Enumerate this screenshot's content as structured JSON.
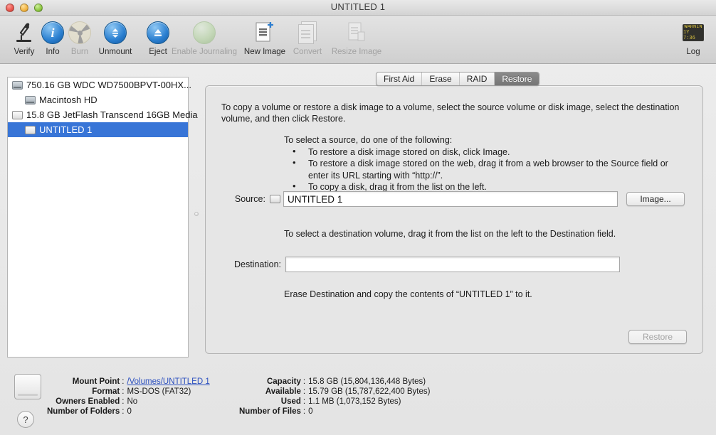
{
  "window": {
    "title": "UNTITLED 1",
    "traffic_lights": [
      "close",
      "minimize",
      "zoom"
    ]
  },
  "toolbar": {
    "items": [
      {
        "label": "Verify",
        "icon": "microscope-icon",
        "enabled": true
      },
      {
        "label": "Info",
        "icon": "info-circle-icon",
        "enabled": true
      },
      {
        "label": "Burn",
        "icon": "burn-radiation-icon",
        "enabled": false
      },
      {
        "label": "Unmount",
        "icon": "unmount-icon",
        "enabled": true
      },
      {
        "label": "Eject",
        "icon": "eject-icon",
        "enabled": true
      },
      {
        "label": "Enable Journaling",
        "icon": "journaling-sphere-icon",
        "enabled": false
      },
      {
        "label": "New Image",
        "icon": "new-image-icon",
        "enabled": true
      },
      {
        "label": "Convert",
        "icon": "convert-icon",
        "enabled": false
      },
      {
        "label": "Resize Image",
        "icon": "resize-image-icon",
        "enabled": false
      }
    ],
    "log": {
      "label": "Log",
      "icon": "log-console-icon",
      "line1": "WARNIN",
      "line2": "1Y 7:36"
    }
  },
  "sidebar": {
    "items": [
      {
        "label": "750.16 GB WDC WD7500BPVT-00HX...",
        "type": "disk",
        "indent": false,
        "selected": false
      },
      {
        "label": "Macintosh HD",
        "type": "volume",
        "indent": true,
        "selected": false
      },
      {
        "label": "15.8 GB JetFlash Transcend 16GB Media",
        "type": "disk",
        "indent": false,
        "selected": false
      },
      {
        "label": "UNTITLED 1",
        "type": "volume",
        "indent": true,
        "selected": true
      }
    ]
  },
  "tabs": [
    {
      "label": "First Aid",
      "active": false
    },
    {
      "label": "Erase",
      "active": false
    },
    {
      "label": "RAID",
      "active": false
    },
    {
      "label": "Restore",
      "active": true
    }
  ],
  "restore": {
    "intro": "To copy a volume or restore a disk image to a volume, select the source volume or disk image, select the destination volume, and then click Restore.",
    "howto_title": "To select a source, do one of the following:",
    "howto_bullets": [
      "To restore a disk image stored on disk, click Image.",
      "To restore a disk image stored on the web, drag it from a web browser to the Source field or enter its URL starting with “http://”.",
      "To copy a disk, drag it from the list on the left."
    ],
    "source_label": "Source:",
    "source_value": "UNTITLED 1",
    "image_button": "Image...",
    "destination_hint": "To select a destination volume, drag it from the list on the left to the Destination field.",
    "destination_label": "Destination:",
    "destination_value": "",
    "erase_message": "Erase Destination and copy the contents of “UNTITLED 1” to it.",
    "restore_button": "Restore"
  },
  "info": {
    "left": [
      {
        "key": "Mount Point",
        "value": "/Volumes/UNTITLED 1",
        "link": true
      },
      {
        "key": "Format",
        "value": "MS-DOS (FAT32)",
        "link": false
      },
      {
        "key": "Owners Enabled",
        "value": "No",
        "link": false
      },
      {
        "key": "Number of Folders",
        "value": "0",
        "link": false
      }
    ],
    "right": [
      {
        "key": "Capacity",
        "value": "15.8 GB (15,804,136,448 Bytes)"
      },
      {
        "key": "Available",
        "value": "15.79 GB (15,787,622,400 Bytes)"
      },
      {
        "key": "Used",
        "value": "1.1 MB (1,073,152 Bytes)"
      },
      {
        "key": "Number of Files",
        "value": "0"
      }
    ],
    "separator": ":",
    "help_label": "?"
  },
  "colors": {
    "selection_blue": "#3875d7",
    "link_blue": "#2b4fbf",
    "tab_active": "#7a7a7a",
    "toolbar_bg": "#d8d8d8"
  }
}
